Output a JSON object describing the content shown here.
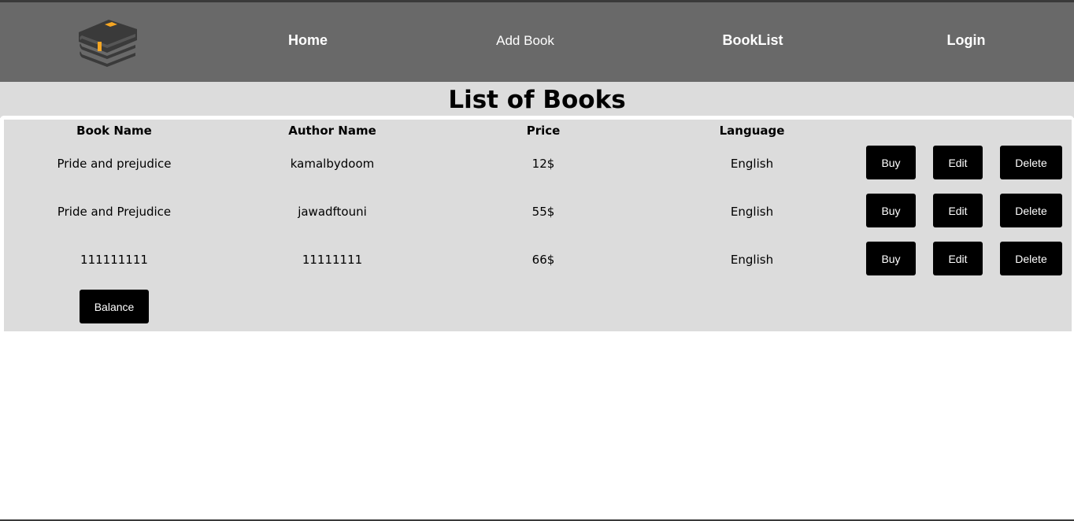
{
  "nav": {
    "home": "Home",
    "add_book": "Add Book",
    "booklist": "BookList",
    "login": "Login"
  },
  "page_title": "List of Books",
  "table": {
    "headers": [
      "Book Name",
      "Author Name",
      "Price",
      "Language"
    ],
    "rows": [
      {
        "book_name": "Pride and prejudice",
        "author_name": "kamalbydoom",
        "price": "12$",
        "language": "English"
      },
      {
        "book_name": "Pride and Prejudice",
        "author_name": "jawadftouni",
        "price": "55$",
        "language": "English"
      },
      {
        "book_name": "111111111",
        "author_name": "11111111",
        "price": "66$",
        "language": "English"
      }
    ],
    "actions": {
      "buy": "Buy",
      "edit": "Edit",
      "delete": "Delete"
    }
  },
  "balance_label": "Balance",
  "colors": {
    "header_bg": "#696969",
    "band_bg": "#dcdcdc",
    "button_bg": "#000000",
    "logo_accent": "#f5a623"
  }
}
